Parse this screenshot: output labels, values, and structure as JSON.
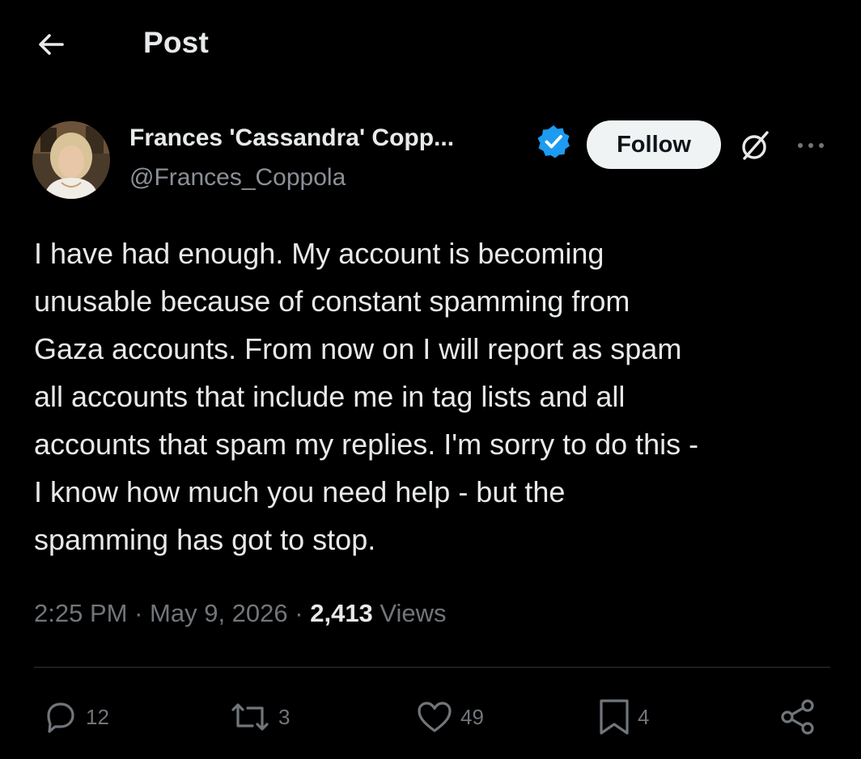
{
  "header": {
    "back_icon": "arrow-left-icon",
    "title": "Post"
  },
  "author": {
    "name": "Frances 'Cassandra' Copp...",
    "handle": "@Frances_Coppola",
    "verified_icon": "verified-badge-icon",
    "verified_color": "#1d9bf0"
  },
  "actions_top": {
    "follow_label": "Follow",
    "grok_icon": "grok-icon",
    "more_icon": "more-dots-icon"
  },
  "post": {
    "text": "I have had enough. My account is becoming\nunusable because of constant spamming from\nGaza accounts. From now on I will report as spam\nall accounts that include me in tag lists and all\naccounts that spam my replies. I'm sorry to do this -\nI know how much you need help - but the\nspamming has got to stop.",
    "time": "2:25 PM",
    "separator": "·",
    "date": "May 9, 2026",
    "views_count": "2,413",
    "views_label": "Views"
  },
  "engagement": {
    "replies": "12",
    "reposts": "3",
    "likes": "49",
    "bookmarks": "4",
    "icons": [
      "reply-icon",
      "repost-icon",
      "like-icon",
      "bookmark-icon",
      "share-icon"
    ]
  },
  "colors": {
    "background": "#000000",
    "text_primary": "#e7e9ea",
    "text_secondary": "#71767b",
    "divider": "#2f3336"
  }
}
